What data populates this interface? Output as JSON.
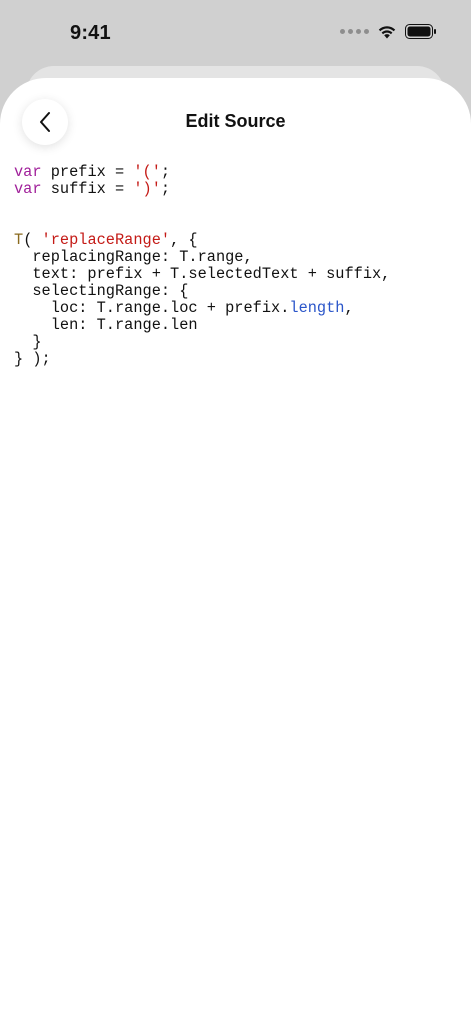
{
  "status_bar": {
    "time": "9:41",
    "icons": [
      "signal-dots-icon",
      "wifi-icon",
      "battery-icon"
    ]
  },
  "nav": {
    "title": "Edit Source",
    "back_icon": "chevron-left-icon"
  },
  "code": {
    "lines": [
      [
        {
          "t": "var",
          "c": "kw"
        },
        {
          "t": " prefix = ",
          "c": ""
        },
        {
          "t": "'('",
          "c": "str"
        },
        {
          "t": ";",
          "c": ""
        }
      ],
      [
        {
          "t": "var",
          "c": "kw"
        },
        {
          "t": " suffix = ",
          "c": ""
        },
        {
          "t": "')'",
          "c": "str"
        },
        {
          "t": ";",
          "c": ""
        }
      ],
      [],
      [],
      [
        {
          "t": "T",
          "c": "fn"
        },
        {
          "t": "( ",
          "c": ""
        },
        {
          "t": "'replaceRange'",
          "c": "str"
        },
        {
          "t": ", {",
          "c": ""
        }
      ],
      [
        {
          "t": "  replacingRange: T.range,",
          "c": ""
        }
      ],
      [
        {
          "t": "  text: prefix + T.selectedText + suffix,",
          "c": ""
        }
      ],
      [
        {
          "t": "  selectingRange: {",
          "c": ""
        }
      ],
      [
        {
          "t": "    loc: T.range.loc + prefix.",
          "c": ""
        },
        {
          "t": "length",
          "c": "prop"
        },
        {
          "t": ",",
          "c": ""
        }
      ],
      [
        {
          "t": "    len: T.range.len",
          "c": ""
        }
      ],
      [
        {
          "t": "  }",
          "c": ""
        }
      ],
      [
        {
          "t": "} );",
          "c": ""
        }
      ]
    ]
  },
  "colors": {
    "keyword": "#a0209a",
    "string": "#c41a16",
    "function": "#8a6a1e",
    "property": "#2a55c9"
  }
}
